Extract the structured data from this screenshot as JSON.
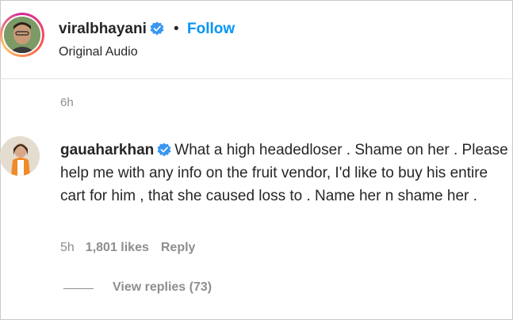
{
  "post": {
    "username": "viralbhayani",
    "separator": "•",
    "follow_label": "Follow",
    "audio_label": "Original Audio",
    "time": "6h"
  },
  "comment": {
    "username": "gauaharkhan",
    "text": "What a high headedloser . Shame on her . Please help me with any info on the fruit vendor, I'd like to buy his entire cart for him , that she caused loss to . Name her n shame her .",
    "time": "5h",
    "likes": "1,801 likes",
    "reply_label": "Reply",
    "view_replies": "View replies (73)"
  },
  "colors": {
    "follow": "#0095f6",
    "verified": "#3897f0",
    "muted": "#8e8e8e",
    "text": "#262626"
  },
  "icons": {
    "verified": "verified-badge-icon"
  }
}
